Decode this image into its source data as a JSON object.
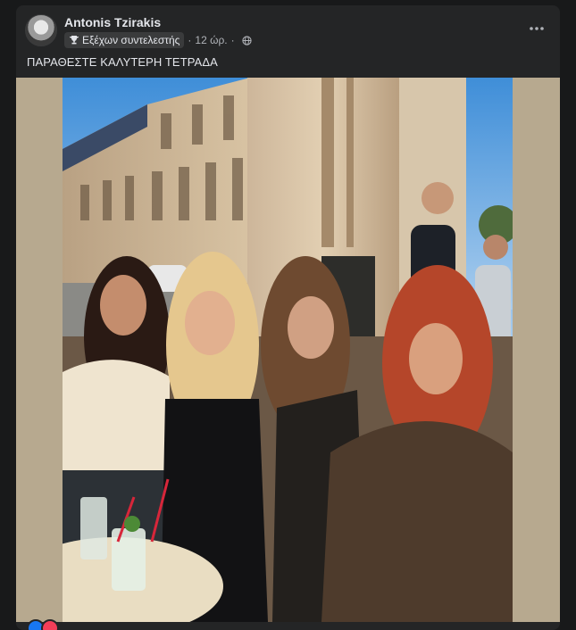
{
  "post": {
    "author": "Antonis Tzirakis",
    "badge_label": "Εξέχων συντελεστής",
    "time": "12 ώρ.",
    "separator": "·",
    "text": "ΠΑΡΑΘΕΣΤΕ ΚΑΛΥΤΕΡΗ ΤΕΤΡΑΔΑ"
  },
  "icons": {
    "more": "more-options-icon",
    "trophy": "trophy-icon",
    "globe": "globe-icon"
  },
  "colors": {
    "background": "#18191a",
    "card": "#242526",
    "text_primary": "#e4e6eb",
    "text_secondary": "#b0b3b8",
    "badge_bg": "#3a3b3c"
  }
}
